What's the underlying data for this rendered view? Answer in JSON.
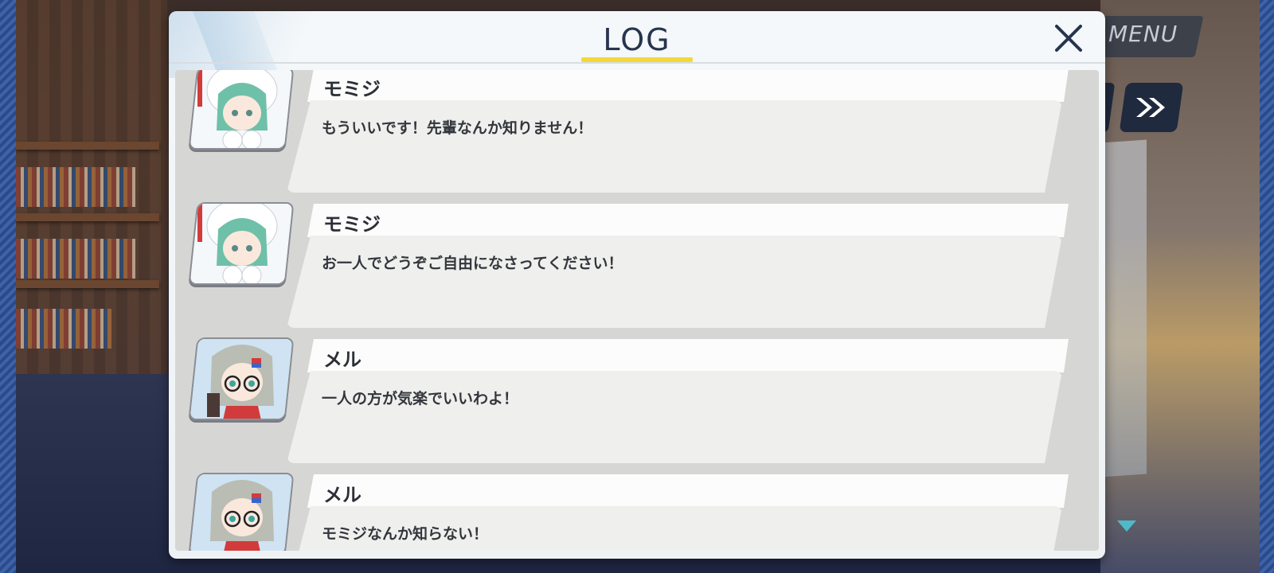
{
  "header": {
    "title": "LOG",
    "menu_label": "MENU"
  },
  "colors": {
    "title_underline": "#f2d83a",
    "accent_next": "#4fb9c9",
    "name_text": "#2c2f36"
  },
  "log": {
    "entries": [
      {
        "speaker": "モミジ",
        "portrait": "momiji-portrait",
        "text": "もういいです！先輩なんか知りません！"
      },
      {
        "speaker": "モミジ",
        "portrait": "momiji-portrait",
        "text": "お一人でどうぞご自由になさってください！"
      },
      {
        "speaker": "メル",
        "portrait": "meru-portrait",
        "text": "一人の方が気楽でいいわよ！"
      },
      {
        "speaker": "メル",
        "portrait": "meru-portrait",
        "text": "モミジなんか知らない！"
      }
    ]
  },
  "icons": {
    "close": "close-icon",
    "skip": "fast-forward-icon",
    "next": "down-triangle-icon"
  }
}
